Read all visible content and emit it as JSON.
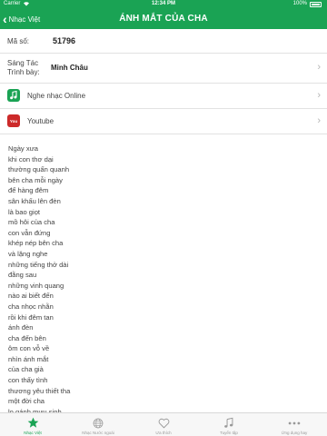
{
  "status_bar": {
    "carrier": "Carrier",
    "time": "12:34 PM",
    "battery": "100%"
  },
  "nav": {
    "back_label": "Nhạc Việt",
    "title": "ÁNH MẮT CỦA CHA"
  },
  "song": {
    "ms_label": "Mã số:",
    "ms_value": "51796",
    "author_label_line1": "Sáng Tác",
    "author_label_line2": "Trình bày:",
    "author_value": "Minh Châu"
  },
  "links": {
    "listen_label": "Nghe nhạc Online",
    "youtube_label": "Youtube",
    "youtube_icon_text": "You"
  },
  "lyrics": [
    "Ngày xưa",
    "khi con thơ dại",
    "thường quấn quanh",
    "bên cha mỗi ngày",
    "để hàng đêm",
    "sân khấu lên đèn",
    "là bao giọt",
    "mồ hôi của cha",
    "con vẫn đứng",
    "khép nép bên cha",
    "và lặng nghe",
    "những tiếng thở dài",
    "đằng sau",
    "những vinh quang",
    "nào ai biết đến",
    "cha nhọc nhằn",
    "rồi khi đêm tan",
    "ánh đèn",
    "cha đến bên",
    "ôm con vỗ về",
    "nhìn ánh mắt",
    "của cha già",
    "con thấy tình",
    "thương yêu thiết tha",
    "một đời cha",
    "lo gánh mưu sinh"
  ],
  "tabs": [
    {
      "label": "Nhạc Việt",
      "icon": "star-icon",
      "active": true
    },
    {
      "label": "Nhạc Nước ngoài",
      "icon": "globe-icon",
      "active": false
    },
    {
      "label": "Ưa thích",
      "icon": "heart-icon",
      "active": false
    },
    {
      "label": "Tuyển tập",
      "icon": "music-notes-icon",
      "active": false
    },
    {
      "label": "Ứng dụng hay",
      "icon": "more-icon",
      "active": false
    }
  ],
  "colors": {
    "brand": "#1aa354",
    "youtube": "#cc2a2a"
  }
}
